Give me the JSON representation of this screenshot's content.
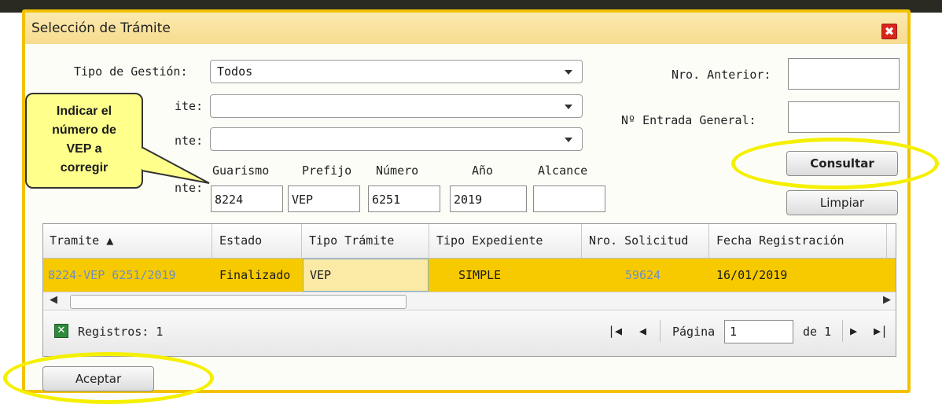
{
  "dialog": {
    "title": "Selección de Trámite",
    "close_glyph": "✖"
  },
  "form": {
    "tipo_gestion_label": "Tipo de Gestión:",
    "tipo_gestion_value": "Todos",
    "tipo_tramite_label_partial": "ite:",
    "tipo_tramite_value": "",
    "third_label_partial": "nte:",
    "third_value": "",
    "expediente_label_partial": "nte:",
    "nro_anterior_label": "Nro. Anterior:",
    "nro_anterior_value": "",
    "entrada_general_label": "Nº Entrada General:",
    "entrada_general_value": "",
    "guarismo_label": "Guarismo",
    "guarismo_value": "8224",
    "prefijo_label": "Prefijo",
    "prefijo_value": "VEP",
    "numero_label": "Número",
    "numero_value": "6251",
    "anio_label": "Año",
    "anio_value": "2019",
    "alcance_label": "Alcance",
    "alcance_value": ""
  },
  "buttons": {
    "consultar": "Consultar",
    "limpiar": "Limpiar",
    "aceptar": "Aceptar"
  },
  "grid": {
    "columns": [
      "Tramite ▲",
      "Estado",
      "Tipo Trámite",
      "Tipo Expediente",
      "Nro. Solicitud",
      "Fecha Registración"
    ],
    "rows": [
      [
        "8224-VEP 6251/2019",
        "Finalizado",
        "VEP",
        "SIMPLE",
        "59624",
        "16/01/2019"
      ]
    ]
  },
  "pager": {
    "records_text": "Registros: 1",
    "page_label": "Página",
    "page_value": "1",
    "page_of": "de 1"
  },
  "callout": {
    "lines": [
      "Indicar el",
      "número de",
      "VEP a",
      "corregir"
    ]
  },
  "colors": {
    "accent": "#f2c200",
    "row_highlight": "#f7ca00",
    "highlight_ellipse": "#f5f000",
    "link_text": "#6d8fc0"
  }
}
